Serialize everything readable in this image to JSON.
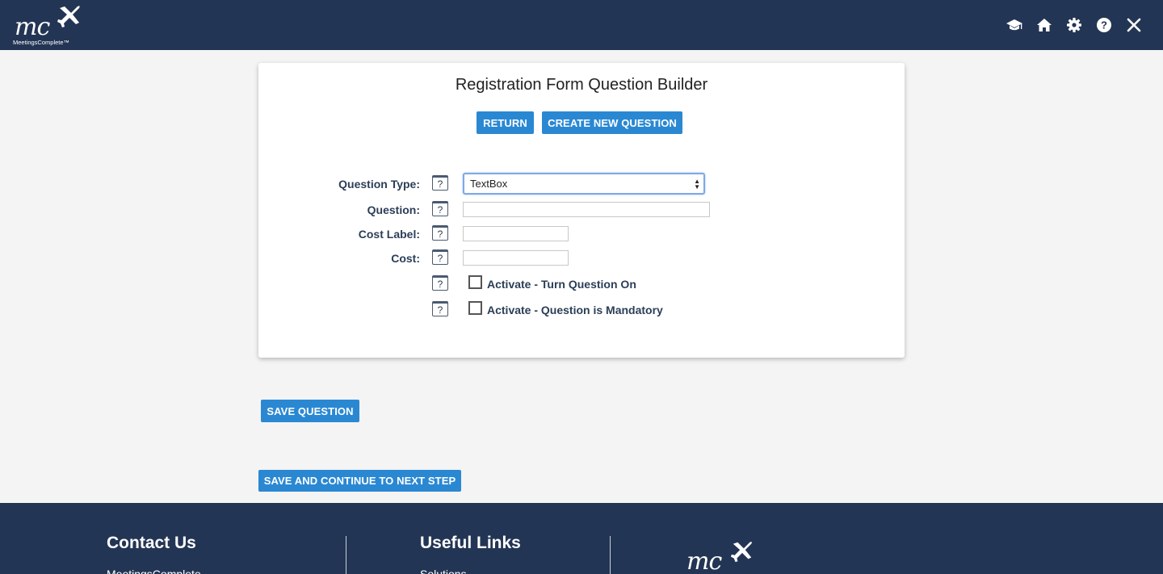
{
  "header": {
    "logo_text": "mc",
    "logo_subtext": "MeetingsComplete™",
    "icons": [
      "graduation-cap-icon",
      "home-icon",
      "gear-icon",
      "help-icon",
      "close-icon"
    ]
  },
  "card": {
    "title": "Registration Form Question Builder",
    "return_label": "RETURN",
    "create_label": "CREATE NEW QUESTION",
    "fields": {
      "question_type_label": "Question Type:",
      "question_type_value": "TextBox",
      "question_label": "Question:",
      "question_value": "",
      "cost_label_label": "Cost Label:",
      "cost_label_value": "",
      "cost_label": "Cost:",
      "cost_value": ""
    },
    "help_glyph": "?",
    "checkboxes": [
      {
        "label": "Activate - Turn Question On",
        "checked": false
      },
      {
        "label": "Activate - Question is Mandatory",
        "checked": false
      }
    ]
  },
  "actions": {
    "save_question_label": "SAVE QUESTION",
    "save_continue_label": "SAVE AND CONTINUE TO NEXT STEP"
  },
  "footer": {
    "contact_heading": "Contact Us",
    "contact_sub": "MeetingsComplete",
    "links_heading": "Useful Links",
    "links_sub": "Solutions",
    "logo_text": "mc"
  },
  "colors": {
    "navy": "#233554",
    "button_blue": "#2a88d3",
    "label_text": "#2b3e57"
  }
}
